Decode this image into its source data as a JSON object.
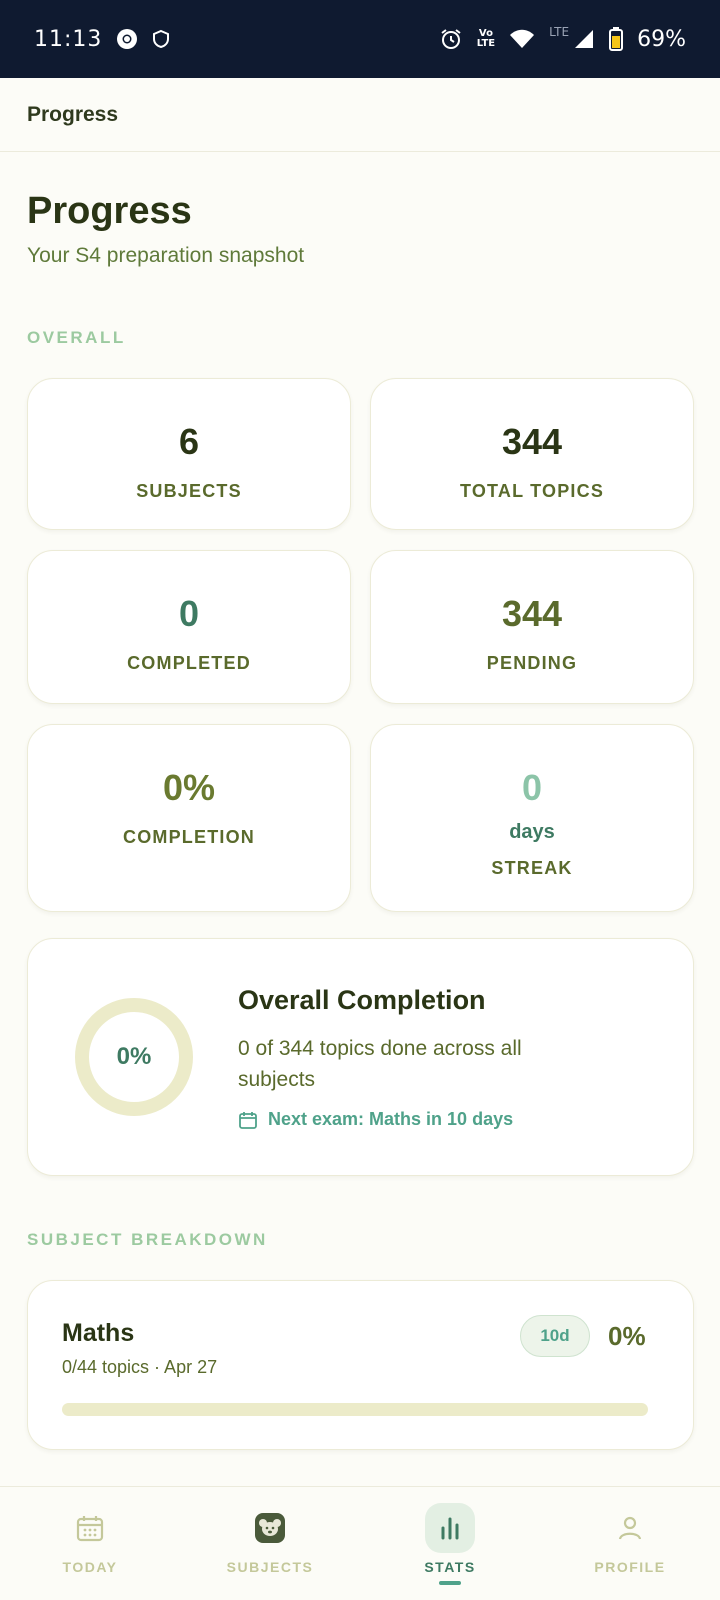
{
  "status_bar": {
    "time": "11:13",
    "volte_top": "Vo",
    "volte_bottom": "LTE",
    "lte": "LTE",
    "battery": "69%"
  },
  "appbar": {
    "title": "Progress"
  },
  "header": {
    "title": "Progress",
    "subtitle": "Your S4 preparation snapshot"
  },
  "overall": {
    "label": "OVERALL",
    "subjects": {
      "value": "6",
      "label": "SUBJECTS"
    },
    "total_topics": {
      "value": "344",
      "label": "TOTAL TOPICS"
    },
    "completed": {
      "value": "0",
      "label": "COMPLETED"
    },
    "pending": {
      "value": "344",
      "label": "PENDING"
    },
    "completion": {
      "value": "0%",
      "label": "COMPLETION"
    },
    "streak": {
      "value": "0",
      "unit": "days",
      "label": "STREAK"
    }
  },
  "overall_completion": {
    "title": "Overall Completion",
    "percent_text": "0%",
    "percent": 0,
    "description": "0 of 344 topics done across all subjects",
    "next_exam": "Next exam: Maths in 10 days"
  },
  "breakdown": {
    "label": "SUBJECT BREAKDOWN",
    "subjects": [
      {
        "name": "Maths",
        "meta": "0/44 topics · Apr 27",
        "badge": "10d",
        "percent_text": "0%",
        "progress": 0
      }
    ]
  },
  "nav": {
    "today": "TODAY",
    "subjects": "SUBJECTS",
    "stats": "STATS",
    "profile": "PROFILE"
  },
  "colors": {
    "accent": "#4fa28a",
    "olive": "#5a6a2c",
    "ring_track": "#ecebc9",
    "status_bar": "#0f1a30"
  }
}
